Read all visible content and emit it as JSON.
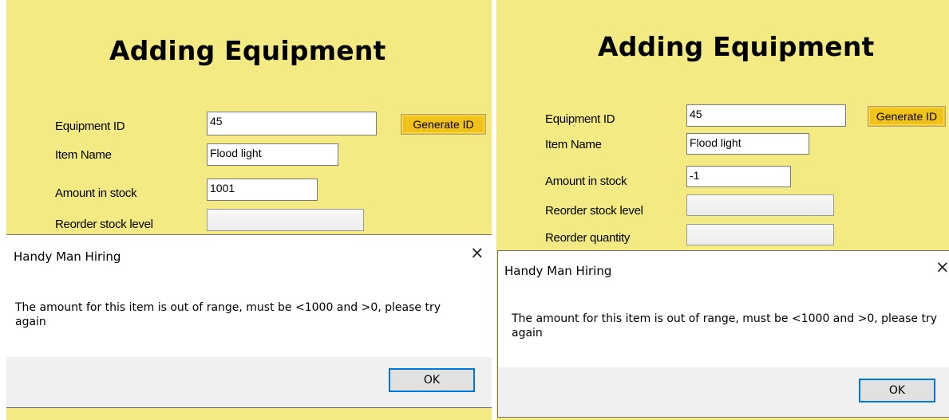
{
  "left": {
    "form": {
      "title": "Adding Equipment",
      "labels": {
        "equipment_id": "Equipment ID",
        "item_name": "Item Name",
        "amount_in_stock": "Amount in stock",
        "reorder_stock_level": "Reorder stock level"
      },
      "values": {
        "equipment_id": "45",
        "item_name": "Flood light",
        "amount_in_stock": "1001",
        "reorder_stock_level": ""
      },
      "generate_button": "Generate ID"
    },
    "dialog": {
      "title": "Handy Man Hiring",
      "close_glyph": "×",
      "message": "The amount for this item is out of range, must be <1000 and >0, please try again",
      "ok_label": "OK"
    }
  },
  "right": {
    "form": {
      "title": "Adding Equipment",
      "labels": {
        "equipment_id": "Equipment ID",
        "item_name": "Item Name",
        "amount_in_stock": "Amount in stock",
        "reorder_stock_level": "Reorder stock level",
        "reorder_quantity": "Reorder quantity"
      },
      "values": {
        "equipment_id": "45",
        "item_name": "Flood light",
        "amount_in_stock": "-1",
        "reorder_stock_level": "",
        "reorder_quantity": ""
      },
      "generate_button": "Generate ID"
    },
    "dialog": {
      "title": "Handy Man Hiring",
      "close_glyph": "×",
      "message": "The amount for this item is out of range, must be <1000 and >0, please try again",
      "ok_label": "OK"
    }
  },
  "colors": {
    "form_background": "#f3ea83",
    "generate_button": "#f0c21a",
    "dialog_footer": "#f0f0f0",
    "ok_border_focus": "#0078d7"
  }
}
